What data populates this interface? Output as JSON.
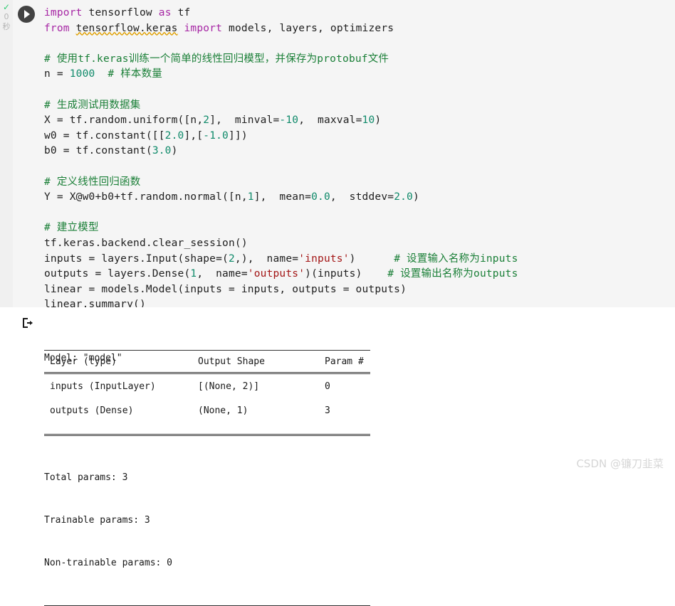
{
  "cell": {
    "gutter": {
      "check_icon": "check-icon",
      "elapsed": "0",
      "unit": "秒"
    },
    "run_button_icon": "play-icon",
    "code_lines": [
      {
        "segs": [
          {
            "t": "import",
            "c": "kw"
          },
          {
            "t": " tensorflow ",
            "c": ""
          },
          {
            "t": "as",
            "c": "kw"
          },
          {
            "t": " tf",
            "c": ""
          }
        ]
      },
      {
        "segs": [
          {
            "t": "from",
            "c": "kw"
          },
          {
            "t": " ",
            "c": ""
          },
          {
            "t": "tensorflow.keras",
            "c": "sq"
          },
          {
            "t": " ",
            "c": ""
          },
          {
            "t": "import",
            "c": "kw"
          },
          {
            "t": " models, layers, optimizers",
            "c": ""
          }
        ]
      },
      {
        "segs": []
      },
      {
        "segs": [
          {
            "t": "# 使用tf.keras训练一个简单的线性回归模型，并保存为protobuf文件",
            "c": "cm"
          }
        ]
      },
      {
        "segs": [
          {
            "t": "n = ",
            "c": ""
          },
          {
            "t": "1000",
            "c": "num"
          },
          {
            "t": "  ",
            "c": ""
          },
          {
            "t": "# 样本数量",
            "c": "cm"
          }
        ]
      },
      {
        "segs": []
      },
      {
        "segs": [
          {
            "t": "# 生成测试用数据集",
            "c": "cm"
          }
        ]
      },
      {
        "segs": [
          {
            "t": "X = tf.random.uniform([n,",
            "c": ""
          },
          {
            "t": "2",
            "c": "num"
          },
          {
            "t": "],  minval=",
            "c": ""
          },
          {
            "t": "-10",
            "c": "num"
          },
          {
            "t": ",  maxval=",
            "c": ""
          },
          {
            "t": "10",
            "c": "num"
          },
          {
            "t": ")",
            "c": ""
          }
        ]
      },
      {
        "segs": [
          {
            "t": "w0 = tf.constant([[",
            "c": ""
          },
          {
            "t": "2.0",
            "c": "num"
          },
          {
            "t": "],[",
            "c": ""
          },
          {
            "t": "-1.0",
            "c": "num"
          },
          {
            "t": "]])",
            "c": ""
          }
        ]
      },
      {
        "segs": [
          {
            "t": "b0 = tf.constant(",
            "c": ""
          },
          {
            "t": "3.0",
            "c": "num"
          },
          {
            "t": ")",
            "c": ""
          }
        ]
      },
      {
        "segs": []
      },
      {
        "segs": [
          {
            "t": "# 定义线性回归函数",
            "c": "cm"
          }
        ]
      },
      {
        "segs": [
          {
            "t": "Y = X@w0+b0+tf.random.normal([n,",
            "c": ""
          },
          {
            "t": "1",
            "c": "num"
          },
          {
            "t": "],  mean=",
            "c": ""
          },
          {
            "t": "0.0",
            "c": "num"
          },
          {
            "t": ",  stddev=",
            "c": ""
          },
          {
            "t": "2.0",
            "c": "num"
          },
          {
            "t": ")",
            "c": ""
          }
        ]
      },
      {
        "segs": []
      },
      {
        "segs": [
          {
            "t": "# 建立模型",
            "c": "cm"
          }
        ]
      },
      {
        "segs": [
          {
            "t": "tf.keras.backend.clear_session()",
            "c": ""
          }
        ]
      },
      {
        "segs": [
          {
            "t": "inputs = layers.Input(shape=(",
            "c": ""
          },
          {
            "t": "2",
            "c": "num"
          },
          {
            "t": ",),  name=",
            "c": ""
          },
          {
            "t": "'inputs'",
            "c": "str"
          },
          {
            "t": ")      ",
            "c": ""
          },
          {
            "t": "# 设置输入名称为inputs",
            "c": "cm"
          }
        ]
      },
      {
        "segs": [
          {
            "t": "outputs = layers.Dense(",
            "c": ""
          },
          {
            "t": "1",
            "c": "num"
          },
          {
            "t": ",  name=",
            "c": ""
          },
          {
            "t": "'outputs'",
            "c": "str"
          },
          {
            "t": ")(inputs)    ",
            "c": ""
          },
          {
            "t": "# 设置输出名称为outputs",
            "c": "cm"
          }
        ]
      },
      {
        "segs": [
          {
            "t": "linear = models.Model(inputs = inputs, outputs = outputs)",
            "c": ""
          }
        ]
      },
      {
        "segs": [
          {
            "t": "linear.summary()",
            "c": ""
          }
        ]
      }
    ]
  },
  "output": {
    "icon": "output-arrow-icon",
    "model_title": "Model: \"model\"",
    "table": {
      "headers": [
        "Layer (type)",
        "Output Shape",
        "Param #"
      ],
      "rows": [
        [
          "inputs (InputLayer)",
          "[(None, 2)]",
          "0"
        ],
        [
          "outputs (Dense)",
          "(None, 1)",
          "3"
        ]
      ]
    },
    "totals": [
      "Total params: 3",
      "Trainable params: 3",
      "Non-trainable params: 0"
    ]
  },
  "watermark": {
    "text": "CSDN @镰刀韭菜"
  },
  "colors": {
    "cell_background": "#f5f5f5",
    "keyword": "#a626a4",
    "comment": "#1a7f37",
    "number": "#0f8a6a",
    "string": "#a31515",
    "squiggle": "#e0a000",
    "run_button": "#424242",
    "check": "#2ecc71",
    "watermark": "#d6d6d6"
  }
}
